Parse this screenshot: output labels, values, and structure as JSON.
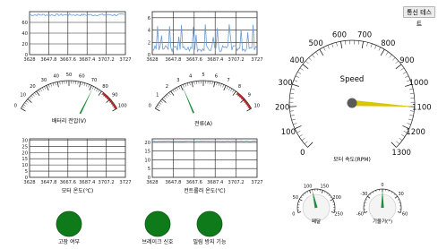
{
  "button": {
    "label": "통신 테스트"
  },
  "colors": {
    "line": "#6a9bd1",
    "needle_green": "#1e8c3a",
    "needle_yellow": "#d9c600",
    "lamp": "#0f7a1a",
    "scale_red": "#c8302a"
  },
  "chart1": {
    "x_ticks": [
      "3628",
      "3647.8",
      "3667.6",
      "3687.4",
      "3707.2",
      "3727"
    ],
    "y_ticks": [
      "0",
      "20",
      "40",
      "60"
    ]
  },
  "chart2": {
    "x_ticks": [
      "3628",
      "3647.8",
      "3667.6",
      "3687.4",
      "3707.2",
      "3727"
    ],
    "y_ticks": [
      "0",
      "2",
      "4",
      "6"
    ]
  },
  "chart3": {
    "x_ticks": [
      "3628",
      "3647.8",
      "3667.6",
      "3687.4",
      "3707.2",
      "3727"
    ],
    "y_ticks": [
      "0",
      "5",
      "10",
      "15",
      "20",
      "25",
      "30"
    ],
    "label": "모터 온도(℃)"
  },
  "chart4": {
    "x_ticks": [
      "3628",
      "3647.8",
      "3667.6",
      "3687.4",
      "3707.2",
      "3727"
    ],
    "y_ticks": [
      "0",
      "5",
      "10",
      "15",
      "20"
    ],
    "label": "컨트롤러 온도(℃)"
  },
  "gauge_voltage": {
    "ticks": [
      "0",
      "10",
      "20",
      "30",
      "40",
      "50",
      "60",
      "70",
      "80",
      "90",
      "100"
    ],
    "label": "배터리 전압(V)",
    "value": 72
  },
  "gauge_current": {
    "ticks": [
      "0",
      "1",
      "2",
      "3",
      "4",
      "5",
      "6",
      "7",
      "8",
      "9",
      "10"
    ],
    "label": "전류(A)",
    "value": 3.1
  },
  "speedometer": {
    "ticks": [
      "0",
      "100",
      "200",
      "300",
      "400",
      "500",
      "600",
      "700",
      "800",
      "900",
      "1000",
      "1100",
      "1200",
      "1300"
    ],
    "title": "Speed",
    "label": "모터 속도(RPM)",
    "value": 1100
  },
  "gauge_pedal": {
    "ticks": [
      "0",
      "50",
      "100",
      "150",
      "200",
      "250"
    ],
    "label": "페달",
    "value": 110
  },
  "gauge_tilt": {
    "ticks": [
      "-60",
      "-30",
      "0",
      "30",
      "60"
    ],
    "label": "기울기(°)",
    "value": 0
  },
  "lamps": [
    {
      "label": "고장 여부"
    },
    {
      "label": "브레이크 신호"
    },
    {
      "label": "밀림 방지 기능"
    }
  ]
}
